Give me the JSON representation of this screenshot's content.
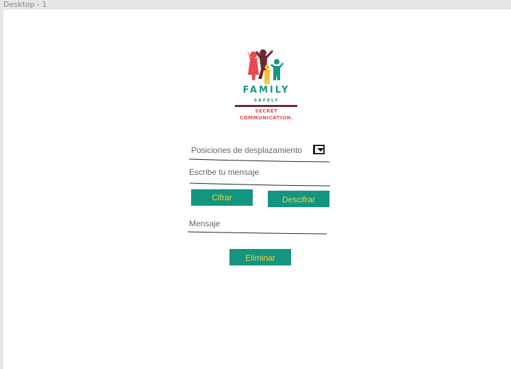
{
  "window": {
    "title": "Desktop - 1"
  },
  "logo": {
    "family": "FAMILY",
    "safely": "SAFELY",
    "line1": "SECRET",
    "line2": "COMMUNICATION.",
    "colors": {
      "teal": "#1a9484",
      "red": "#e84a4a",
      "maroon": "#6b2735",
      "yellow": "#f2c12e"
    }
  },
  "form": {
    "shift_select_label": "Posiciones de desplazamiento",
    "message_placeholder": "Escribe tu mensaje",
    "cipher_button": "Cifrar",
    "decipher_button": "Descifrar",
    "output_label": "Mensaje",
    "delete_button": "Eliminar"
  },
  "colors": {
    "button_bg": "#149580",
    "button_text": "#f6d23a",
    "line": "#222222"
  }
}
